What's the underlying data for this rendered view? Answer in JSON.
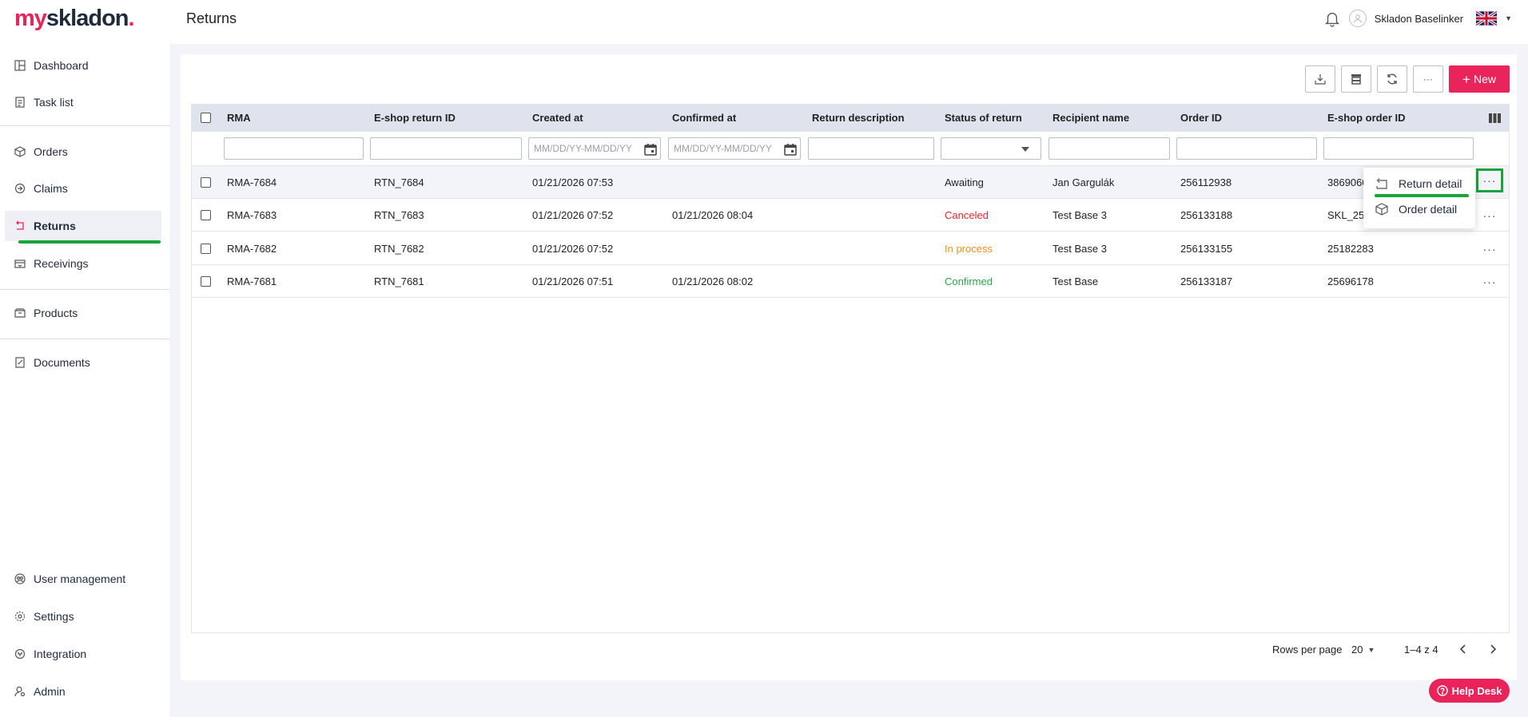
{
  "app": {
    "logo_part1": "my",
    "logo_part2": "skladon",
    "logo_dot": ".",
    "page_title": "Returns",
    "user_name": "Skladon Baselinker"
  },
  "sidebar": {
    "items": [
      {
        "label": "Dashboard",
        "icon": "dashboard-icon"
      },
      {
        "label": "Task list",
        "icon": "task-list-icon"
      },
      {
        "label": "Orders",
        "icon": "box-icon"
      },
      {
        "label": "Claims",
        "icon": "claims-icon"
      },
      {
        "label": "Returns",
        "icon": "returns-icon",
        "active": true
      },
      {
        "label": "Receivings",
        "icon": "receivings-icon"
      },
      {
        "label": "Products",
        "icon": "products-icon"
      },
      {
        "label": "Documents",
        "icon": "documents-icon"
      },
      {
        "label": "User management",
        "icon": "user-management-icon"
      },
      {
        "label": "Settings",
        "icon": "gear-icon"
      },
      {
        "label": "Integration",
        "icon": "integration-icon"
      },
      {
        "label": "Admin",
        "icon": "admin-icon"
      }
    ]
  },
  "toolbar": {
    "new_label": "New",
    "more_label": "···"
  },
  "table": {
    "columns": [
      "RMA",
      "E-shop return ID",
      "Created at",
      "Confirmed at",
      "Return description",
      "Status of return",
      "Recipient name",
      "Order ID",
      "E-shop order ID"
    ],
    "date_placeholder": "MM/DD/YY-MM/DD/YY",
    "rows": [
      {
        "rma": "RMA-7684",
        "eshop_return_id": "RTN_7684",
        "created_at": "01/21/2026 07:53",
        "confirmed_at": "",
        "description": "",
        "status": "Awaiting",
        "recipient": "Jan Gargulák",
        "order_id": "256112938",
        "eshop_order_id": "3869060"
      },
      {
        "rma": "RMA-7683",
        "eshop_return_id": "RTN_7683",
        "created_at": "01/21/2026 07:52",
        "confirmed_at": "01/21/2026 08:04",
        "description": "",
        "status": "Canceled",
        "recipient": "Test Base 3",
        "order_id": "256133188",
        "eshop_order_id": "SKL_25"
      },
      {
        "rma": "RMA-7682",
        "eshop_return_id": "RTN_7682",
        "created_at": "01/21/2026 07:52",
        "confirmed_at": "",
        "description": "",
        "status": "In process",
        "recipient": "Test Base 3",
        "order_id": "256133155",
        "eshop_order_id": "25182283"
      },
      {
        "rma": "RMA-7681",
        "eshop_return_id": "RTN_7681",
        "created_at": "01/21/2026 07:51",
        "confirmed_at": "01/21/2026 08:02",
        "description": "",
        "status": "Confirmed",
        "recipient": "Test Base",
        "order_id": "256133187",
        "eshop_order_id": "25696178"
      }
    ],
    "row_menu_label": "···"
  },
  "popup_menu": {
    "items": [
      {
        "label": "Return detail"
      },
      {
        "label": "Order detail"
      }
    ]
  },
  "pagination": {
    "rows_per_page_label": "Rows per page",
    "rows_per_page_value": "20",
    "range_label": "1–4 z 4"
  },
  "help_desk": {
    "label": "Help Desk"
  },
  "colors": {
    "brand": "#e8245a",
    "highlight": "#1aa33c",
    "canceled": "#e0262c",
    "in_process": "#f0901e",
    "confirmed": "#2aa845"
  }
}
